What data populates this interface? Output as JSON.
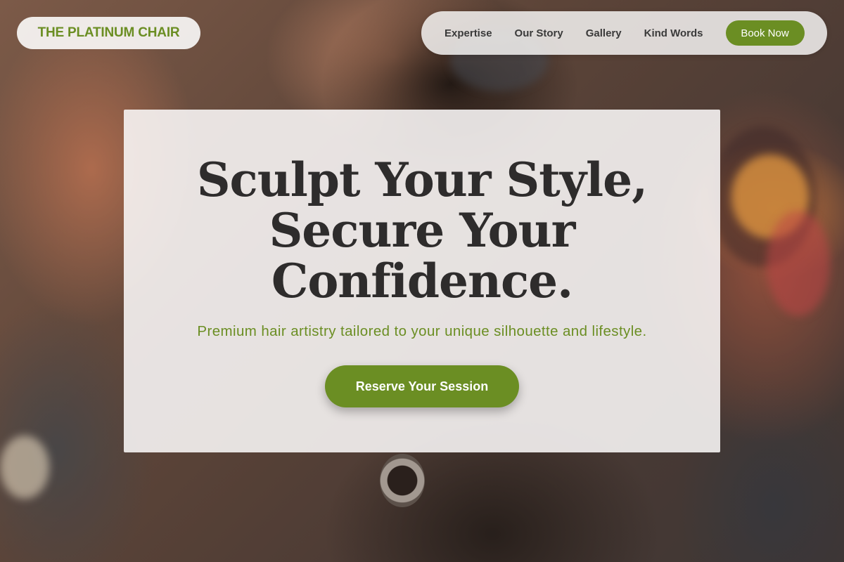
{
  "brand": {
    "name": "THE PLATINUM CHAIR",
    "accent_color": "#6b8e23"
  },
  "nav": {
    "links": [
      {
        "label": "Expertise"
      },
      {
        "label": "Our Story"
      },
      {
        "label": "Gallery"
      },
      {
        "label": "Kind Words"
      }
    ],
    "cta_label": "Book Now"
  },
  "hero": {
    "title_lines": [
      "Sculpt Your Style,",
      "Secure Your",
      "Confidence."
    ],
    "subtitle": "Premium hair artistry tailored to your unique silhouette and lifestyle.",
    "cta_label": "Reserve Your Session",
    "background": "barber-cutting-hair-photo"
  }
}
